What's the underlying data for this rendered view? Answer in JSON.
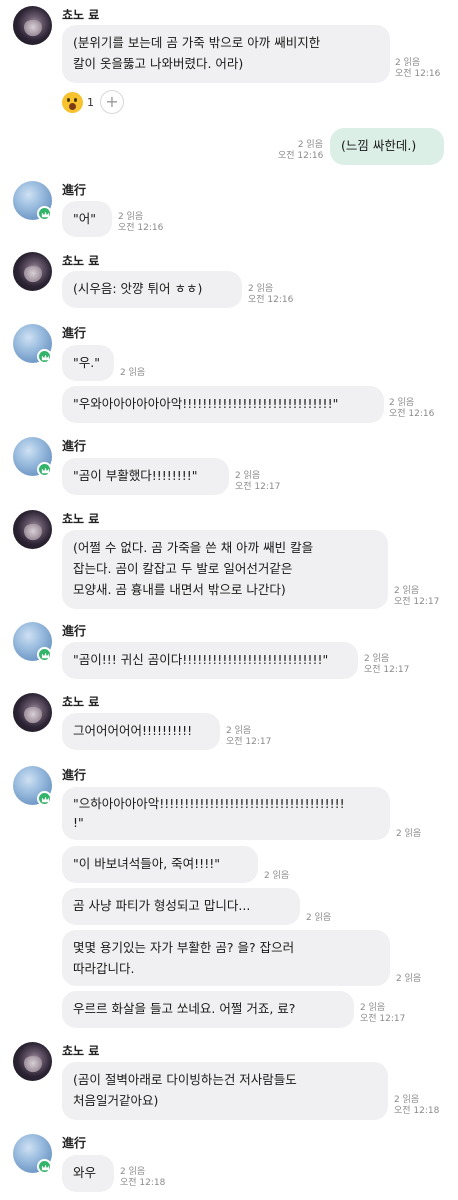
{
  "users": {
    "kyo": "쵸노 료",
    "sin": "進行"
  },
  "reaction": {
    "icon": "wow-emoji-icon",
    "count": "1",
    "add_icon": "add-reaction-icon"
  },
  "msgs": [
    {
      "text": "(분위기를 보는데 곰 가죽 밖으로 아까 쌔비지한\n칼이 옷을뚫고 나와버렸다. 어라)",
      "read": "2 읽음",
      "time": "오전 12:16"
    },
    {
      "text": "(느낌 싸한데.)",
      "read": "2 읽음",
      "time": "오전 12:16"
    },
    {
      "text": "\"어\"",
      "read": "2 읽음",
      "time": "오전 12:16"
    },
    {
      "text": "(시우음: 앗꺙 튀어 ㅎㅎ)",
      "read": "2 읽음",
      "time": "오전 12:16"
    },
    {
      "text": "\"우.\"",
      "read": "2 읽음",
      "time": ""
    },
    {
      "text": "\"우와아아아아아아악!!!!!!!!!!!!!!!!!!!!!!!!!!!!!!\"",
      "read": "2 읽음",
      "time": "오전 12:16"
    },
    {
      "text": "\"곰이 부활했다!!!!!!!!\"",
      "read": "2 읽음",
      "time": "오전 12:17"
    },
    {
      "text": "(어쩔 수 없다. 곰 가죽을 쓴 채 아까 쌔빈 칼을\n잡는다. 곰이 칼잡고 두 발로 일어선거같은\n모양새. 곰 흉내를 내면서 밖으로 나간다)",
      "read": "2 읽음",
      "time": "오전 12:17"
    },
    {
      "text": "\"곰이!!! 귀신 곰이다!!!!!!!!!!!!!!!!!!!!!!!!!!!!\"",
      "read": "2 읽음",
      "time": "오전 12:17"
    },
    {
      "text": "그어어어어어!!!!!!!!!!",
      "read": "2 읽음",
      "time": "오전 12:17"
    },
    {
      "text": "\"으하아아아아악!!!!!!!!!!!!!!!!!!!!!!!!!!!!!!!!!!!!!\n!\"",
      "read": "2 읽음",
      "time": ""
    },
    {
      "text": "\"이 바보녀석들아, 죽여!!!!\"",
      "read": "2 읽음",
      "time": ""
    },
    {
      "text": "곰 사냥 파티가 형성되고 맙니다...",
      "read": "2 읽음",
      "time": ""
    },
    {
      "text": "몇몇 용기있는 자가 부활한 곰? 을? 잡으러\n따라갑니다.",
      "read": "2 읽음",
      "time": ""
    },
    {
      "text": "우르르 화살을 들고 쏘네요. 어쩔 거죠, 료?",
      "read": "2 읽음",
      "time": "오전 12:17"
    },
    {
      "text": "(곰이 절벽아래로 다이빙하는건 저사람들도\n처음일거같아요)",
      "read": "2 읽음",
      "time": "오전 12:18"
    },
    {
      "text": "와우",
      "read": "2 읽음",
      "time": "오전 12:18"
    }
  ]
}
